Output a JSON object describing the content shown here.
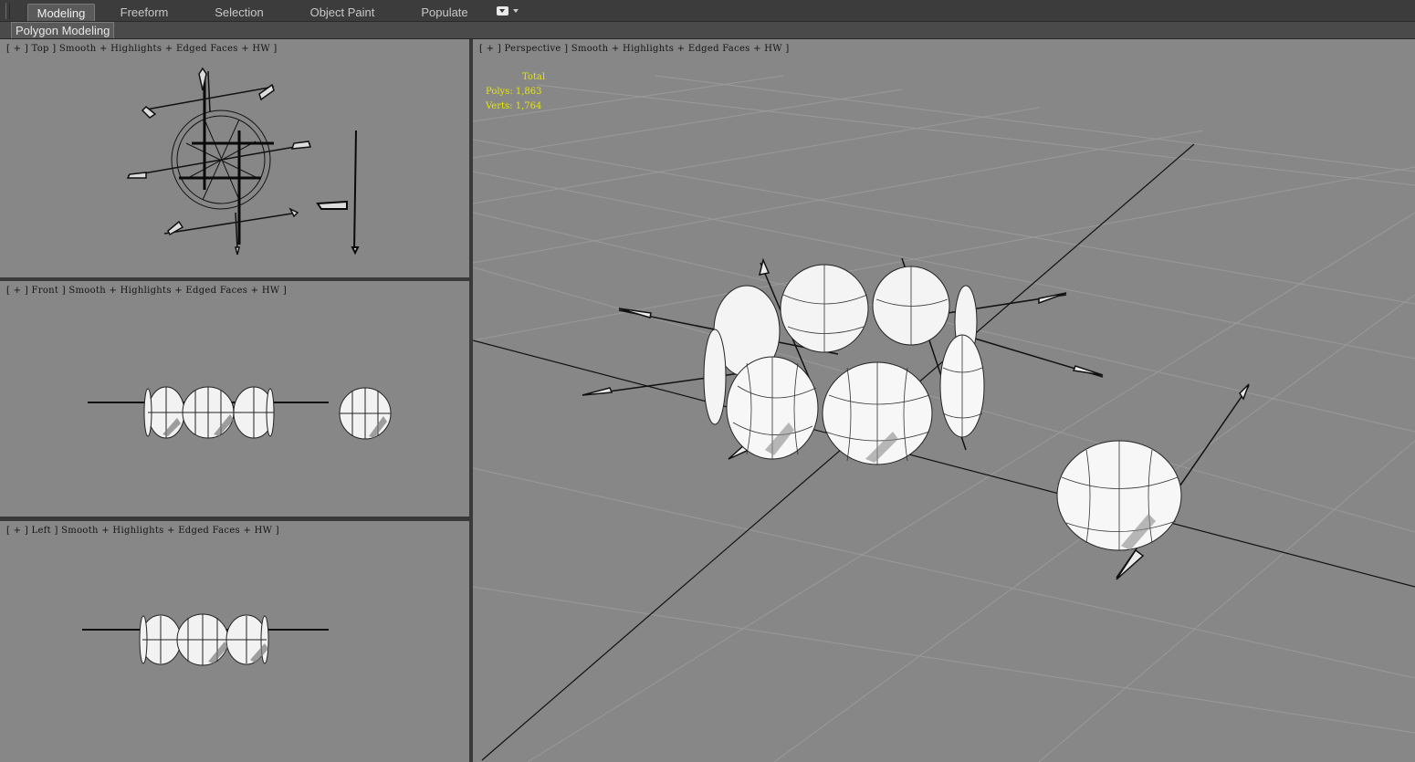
{
  "ribbon": {
    "tabs": [
      "Modeling",
      "Freeform",
      "Selection",
      "Object Paint",
      "Populate"
    ],
    "active_tab": "Modeling",
    "panel_label": "Polygon Modeling"
  },
  "viewports": {
    "top": {
      "label": "[ + ] Top ] Smooth + Highlights + Edged Faces + HW ]"
    },
    "front": {
      "label": "[ + ] Front ] Smooth + Highlights + Edged Faces + HW ]"
    },
    "left": {
      "label": "[ + ] Left ] Smooth + Highlights + Edged Faces + HW ]"
    },
    "perspective": {
      "label": "[ + ] Perspective ] Smooth + Highlights + Edged Faces + HW ]",
      "stats": {
        "header": "Total",
        "polys": "Polys: 1,863",
        "verts": "Verts: 1,764"
      }
    }
  },
  "colors": {
    "viewport_bg": "#878787",
    "stats_text": "#e6e600",
    "frame": "#3a3a3a"
  }
}
